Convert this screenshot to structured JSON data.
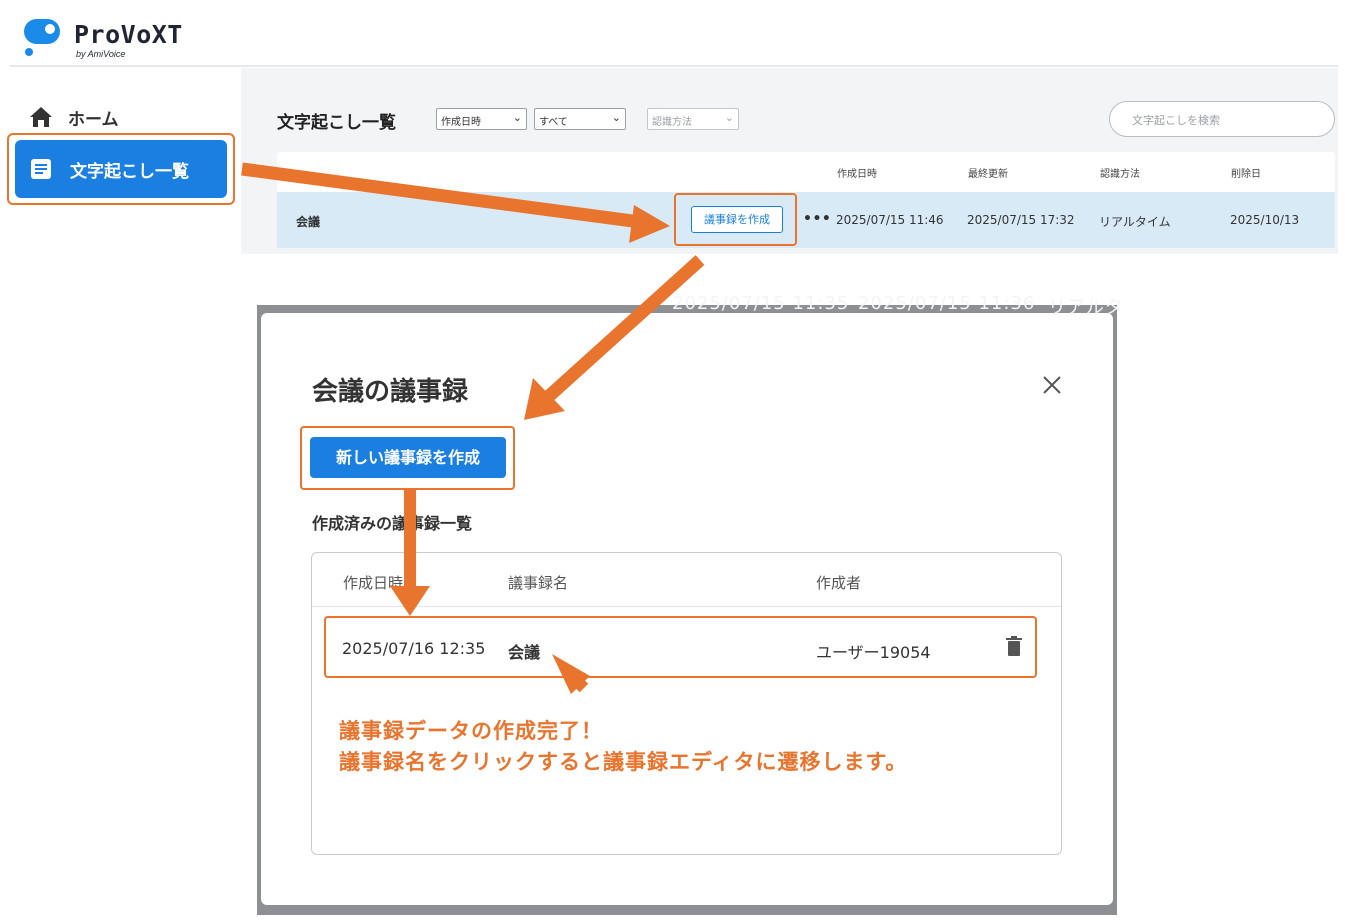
{
  "app": {
    "name": "ProVoXT",
    "byline": "by AmiVoice"
  },
  "sidebar": {
    "items": [
      {
        "label": "ホーム",
        "icon": "home-icon"
      },
      {
        "label": "文字起こし一覧",
        "icon": "document-list-icon",
        "active": true
      }
    ]
  },
  "list": {
    "title": "文字起こし一覧",
    "filters": {
      "sort": "作成日時",
      "scope": "すべて",
      "method": "認識方法"
    },
    "search_placeholder": "文字起こしを検索",
    "columns": [
      "作成日時",
      "最終更新",
      "認識方法",
      "削除日"
    ],
    "row": {
      "name": "会議",
      "action_label": "議事録を作成",
      "more": "•••",
      "created": "2025/07/15 11:46",
      "updated": "2025/07/15 17:32",
      "method": "リアルタイム",
      "delete_date": "2025/10/13"
    }
  },
  "modal": {
    "title": "会議の議事録",
    "new_button": "新しい議事録を作成",
    "section_title": "作成済みの議事録一覧",
    "columns": [
      "作成日時",
      "議事録名",
      "作成者"
    ],
    "rows": [
      {
        "created": "2025/07/16 12:35",
        "name": "会議",
        "author": "ユーザー19054"
      }
    ],
    "background_ghost": [
      "2025/07/15 11:35",
      "2025/07/15 11:36",
      "リアルタ"
    ]
  },
  "annotation": {
    "line1": "議事録データの作成完了！",
    "line2": "議事録名をクリックすると議事録エディタに遷移します。"
  },
  "colors": {
    "accent_blue": "#1a7fe0",
    "highlight_orange": "#e8742e",
    "row_selected": "#d9eaf7"
  }
}
